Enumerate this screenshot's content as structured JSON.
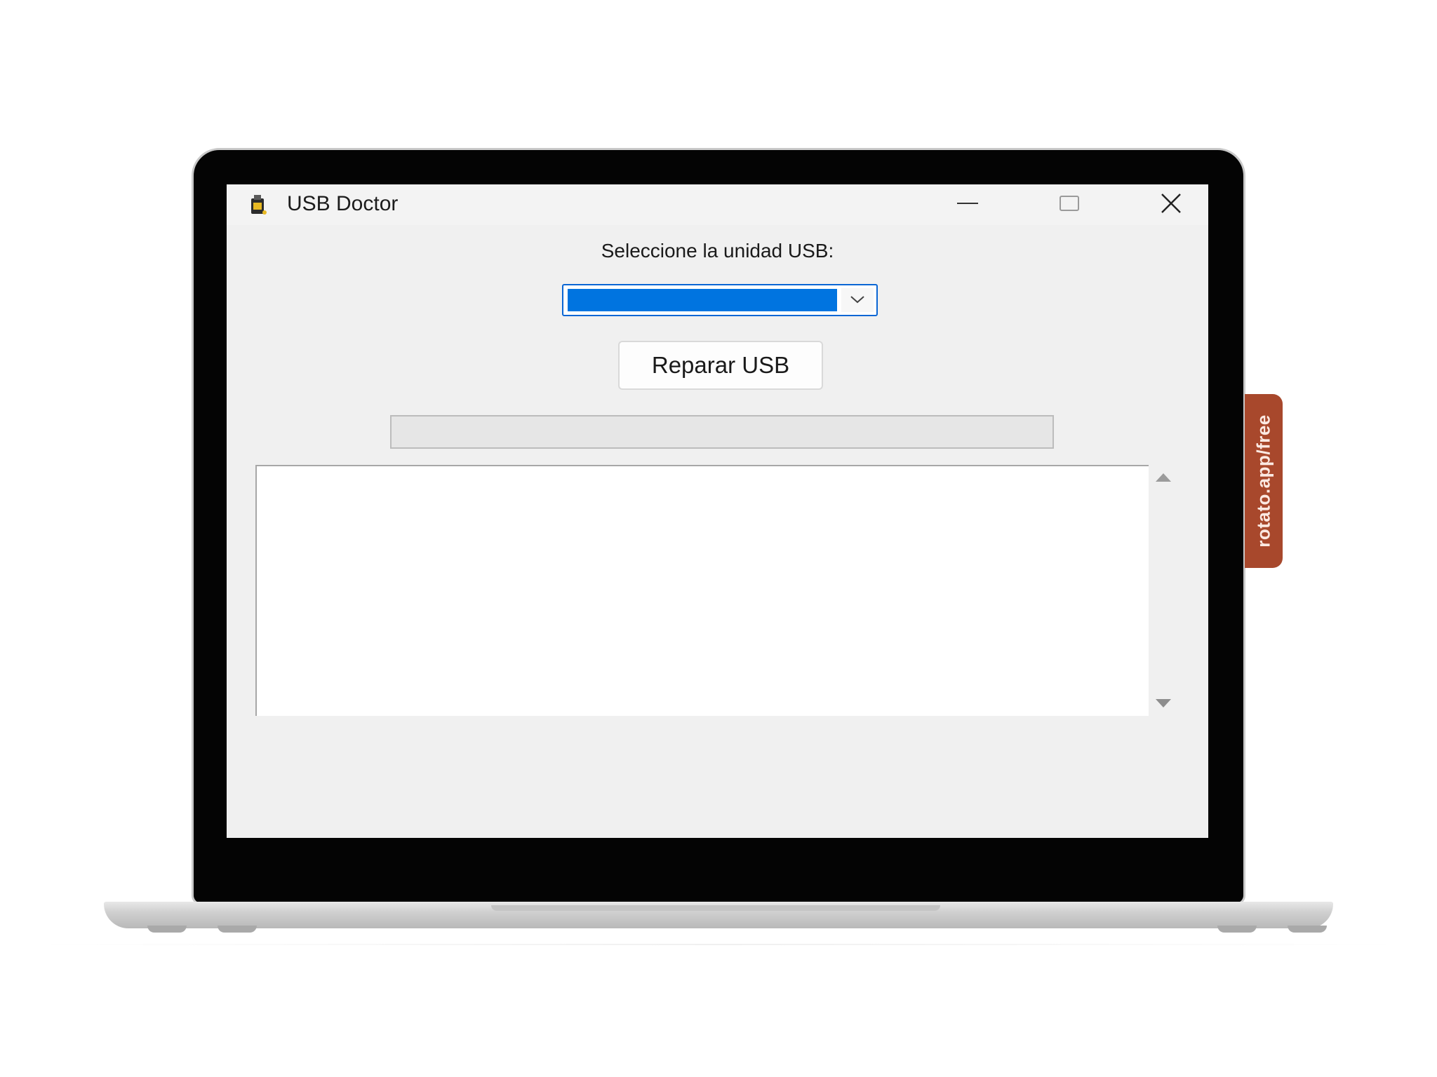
{
  "window": {
    "title": "USB Doctor",
    "app_icon": "usb-doctor-app-icon",
    "controls": {
      "minimize_icon": "minimize-icon",
      "maximize_icon": "maximize-icon",
      "close_icon": "close-icon"
    }
  },
  "main": {
    "select_label": "Seleccione la unidad USB:",
    "drive_select": {
      "selected_value": "",
      "arrow_icon": "chevron-down-icon",
      "highlight_color": "#0074e0"
    },
    "repair_button_label": "Reparar USB",
    "progress": {
      "value": 0,
      "fill_color": "#06b025"
    },
    "log": {
      "text": "",
      "scroll_up_icon": "triangle-up-icon",
      "scroll_down_icon": "triangle-down-icon"
    }
  },
  "watermark": {
    "text": "rotato.app/free",
    "color": "#a8482c"
  }
}
